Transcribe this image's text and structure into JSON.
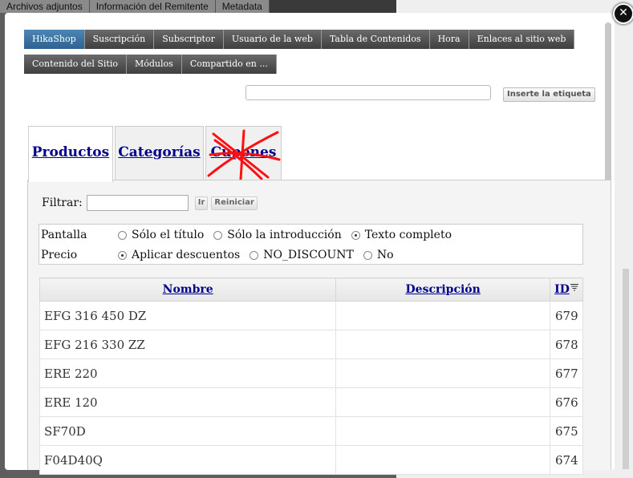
{
  "background_tabs": [
    "Archivos adjuntos",
    "Información del Remitente",
    "Metadata"
  ],
  "close_label": "✕",
  "menu": {
    "row1": [
      {
        "label": "HikaShop",
        "active": true
      },
      {
        "label": "Suscripción"
      },
      {
        "label": "Subscriptor"
      },
      {
        "label": "Usuario de la web"
      },
      {
        "label": "Tabla de Contenidos"
      },
      {
        "label": "Hora"
      },
      {
        "label": "Enlaces al sitio web"
      }
    ],
    "row2": [
      {
        "label": "Contenido del Sitio"
      },
      {
        "label": "Módulos"
      },
      {
        "label": "Compartido en ..."
      }
    ]
  },
  "tag": {
    "input_value": "",
    "button_label": "Inserte la etiqueta"
  },
  "tabs": [
    {
      "label": "Productos",
      "active": true
    },
    {
      "label": "Categorías"
    },
    {
      "label": "Cupones",
      "crossed_out": true
    }
  ],
  "filter": {
    "label": "Filtrar:",
    "value": "",
    "go_label": "Ir",
    "reset_label": "Reiniciar"
  },
  "display_options": {
    "pantalla": {
      "label": "Pantalla",
      "options": [
        "Sólo el título",
        "Sólo la introducción",
        "Texto completo"
      ],
      "selected": "Texto completo"
    },
    "precio": {
      "label": "Precio",
      "options": [
        "Aplicar descuentos",
        "NO_DISCOUNT",
        "No"
      ],
      "selected": "Aplicar descuentos"
    }
  },
  "table": {
    "columns": [
      "Nombre",
      "Descripción",
      "ID"
    ],
    "rows": [
      {
        "nombre": "EFG 316 450 DZ",
        "descripcion": "",
        "id": "679"
      },
      {
        "nombre": "EFG 216 330 ZZ",
        "descripcion": "",
        "id": "678"
      },
      {
        "nombre": "ERE 220",
        "descripcion": "",
        "id": "677"
      },
      {
        "nombre": "ERE 120",
        "descripcion": "",
        "id": "676"
      },
      {
        "nombre": "SF70D",
        "descripcion": "",
        "id": "675"
      },
      {
        "nombre": "F04D40Q",
        "descripcion": "",
        "id": "674"
      }
    ]
  },
  "colors": {
    "menu_active": "#2e6290",
    "link": "#00008b",
    "cross_out": "#ff0000"
  }
}
